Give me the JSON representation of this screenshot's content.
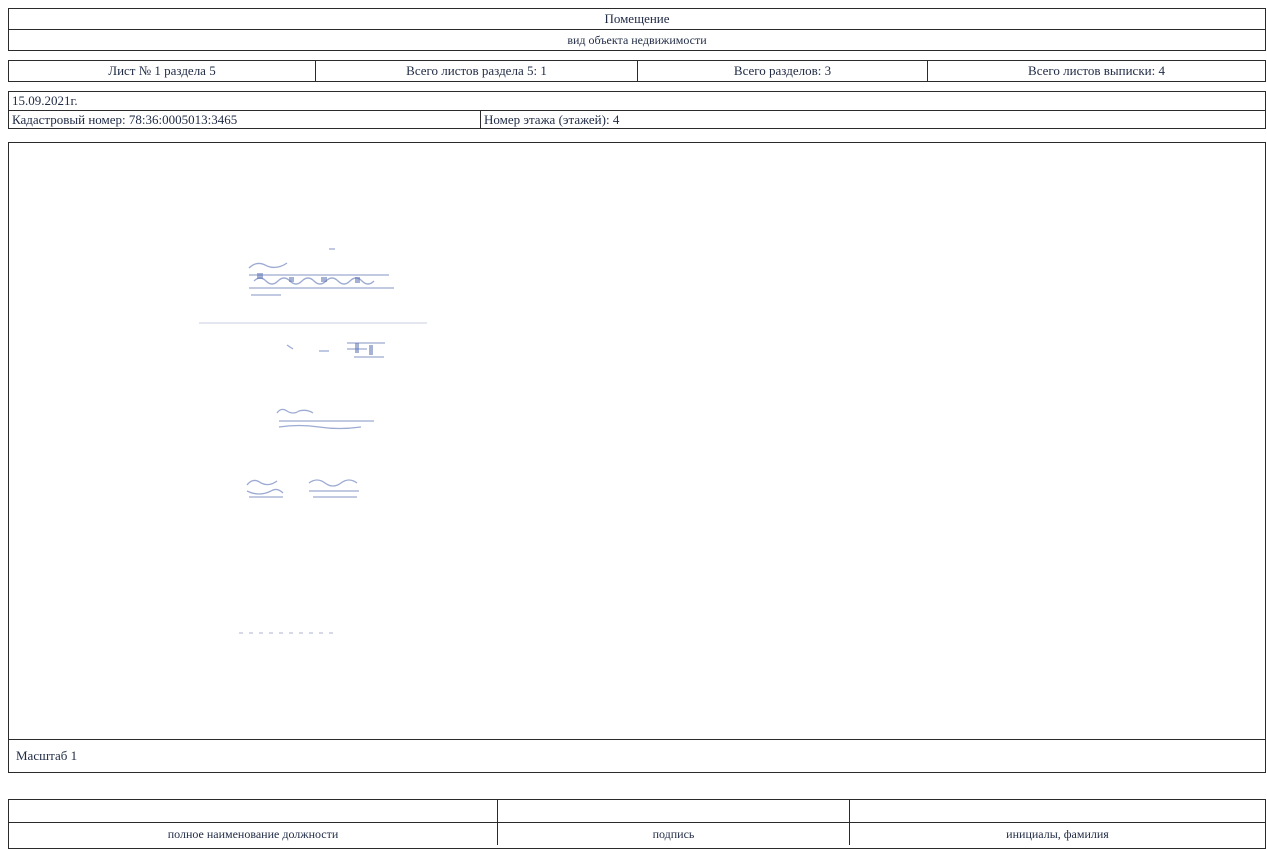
{
  "header": {
    "object_type": "Помещение",
    "object_type_caption": "вид объекта недвижимости"
  },
  "sheet_info": {
    "sheet_of_section": "Лист № 1 раздела 5",
    "total_sheets_section": "Всего листов раздела 5: 1",
    "total_sections": "Всего разделов: 3",
    "total_sheets_extract": "Всего листов выписки: 4"
  },
  "record": {
    "date": "15.09.2021г.",
    "cadastral_number": "Кадастровый номер: 78:36:0005013:3465",
    "floor_number": "Номер этажа (этажей): 4"
  },
  "plan": {
    "scale_label": "Масштаб 1"
  },
  "signature_block": {
    "position_caption": "полное наименование должности",
    "signature_caption": "подпись",
    "name_caption": "инициалы, фамилия"
  }
}
